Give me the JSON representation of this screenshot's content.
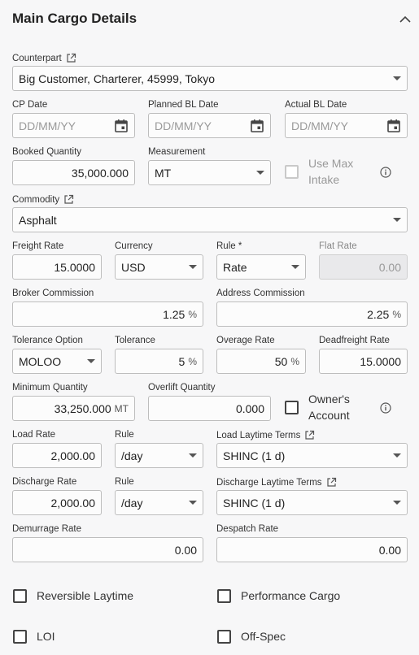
{
  "header": {
    "title": "Main Cargo Details"
  },
  "counterpart": {
    "label": "Counterpart",
    "value": "Big Customer, Charterer, 45999, Tokyo"
  },
  "cp_date": {
    "label": "CP Date",
    "placeholder": "DD/MM/YY"
  },
  "planned_bl_date": {
    "label": "Planned BL Date",
    "placeholder": "DD/MM/YY"
  },
  "actual_bl_date": {
    "label": "Actual BL Date",
    "placeholder": "DD/MM/YY"
  },
  "booked_quantity": {
    "label": "Booked Quantity",
    "value": "35,000.000"
  },
  "measurement": {
    "label": "Measurement",
    "value": "MT"
  },
  "use_max_intake": {
    "label_line1": "Use Max",
    "label_line2": "Intake",
    "checked": false
  },
  "commodity": {
    "label": "Commodity",
    "value": "Asphalt"
  },
  "freight_rate": {
    "label": "Freight Rate",
    "value": "15.0000"
  },
  "currency": {
    "label": "Currency",
    "value": "USD"
  },
  "rule": {
    "label": "Rule *",
    "value": "Rate"
  },
  "flat_rate": {
    "label": "Flat Rate",
    "value": "0.00"
  },
  "broker_commission": {
    "label": "Broker Commission",
    "value": "1.25",
    "unit": "%"
  },
  "address_commission": {
    "label": "Address Commission",
    "value": "2.25",
    "unit": "%"
  },
  "tolerance_option": {
    "label": "Tolerance Option",
    "value": "MOLOO"
  },
  "tolerance": {
    "label": "Tolerance",
    "value": "5",
    "unit": "%"
  },
  "overage_rate": {
    "label": "Overage Rate",
    "value": "50",
    "unit": "%"
  },
  "deadfreight_rate": {
    "label": "Deadfreight Rate",
    "value": "15.0000"
  },
  "minimum_quantity": {
    "label": "Minimum Quantity",
    "value": "33,250.000",
    "unit": "MT"
  },
  "overlift_quantity": {
    "label": "Overlift Quantity",
    "value": "0.000"
  },
  "owners_account": {
    "label_line1": "Owner's",
    "label_line2": "Account",
    "checked": false
  },
  "load_rate": {
    "label": "Load Rate",
    "value": "2,000.00"
  },
  "load_rule": {
    "label": "Rule",
    "value": "/day"
  },
  "load_laytime_terms": {
    "label": "Load Laytime Terms",
    "value": "SHINC (1 d)"
  },
  "discharge_rate": {
    "label": "Discharge Rate",
    "value": "2,000.00"
  },
  "discharge_rule": {
    "label": "Rule",
    "value": "/day"
  },
  "discharge_laytime_terms": {
    "label": "Discharge Laytime Terms",
    "value": "SHINC (1 d)"
  },
  "demurrage_rate": {
    "label": "Demurrage Rate",
    "value": "0.00"
  },
  "despatch_rate": {
    "label": "Despatch Rate",
    "value": "0.00"
  },
  "reversible_laytime": {
    "label": "Reversible Laytime",
    "checked": false
  },
  "performance_cargo": {
    "label": "Performance Cargo",
    "checked": false
  },
  "loi": {
    "label": "LOI",
    "checked": false
  },
  "off_spec": {
    "label": "Off-Spec",
    "checked": false
  }
}
